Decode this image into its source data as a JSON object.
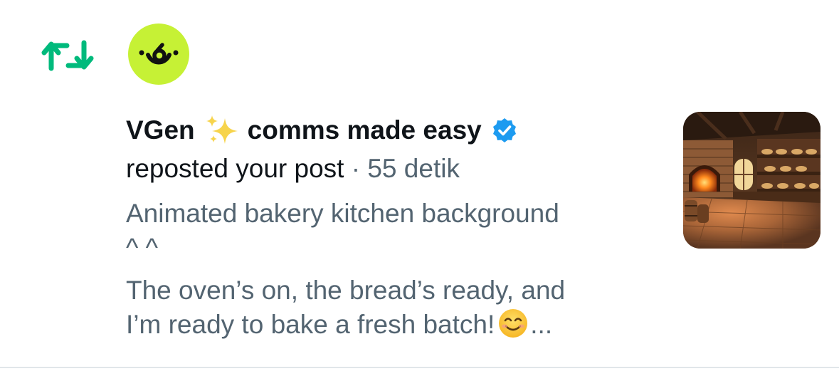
{
  "notification": {
    "type_icon": "repost-icon",
    "accent_color": "#00ba7c",
    "avatar": {
      "icon": "vgen-logo",
      "bg_color": "#c6f135"
    },
    "user": {
      "name": "VGen",
      "name_emoji": "sparkles-emoji",
      "name_rest": "comms made easy",
      "verified": true,
      "verified_color": "#1d9bf0"
    },
    "action": "reposted your post",
    "separator": "·",
    "time": "55 detik",
    "post": {
      "line1": "Animated bakery kitchen background",
      "line2": "^ ^",
      "line3": "The oven’s on, the bread’s ready, and",
      "line4": "I’m ready to bake a fresh batch!",
      "line4_emoji": "smiling-face-emoji",
      "ellipsis": "..."
    },
    "thumbnail": {
      "subject": "bakery-kitchen-illustration"
    }
  }
}
